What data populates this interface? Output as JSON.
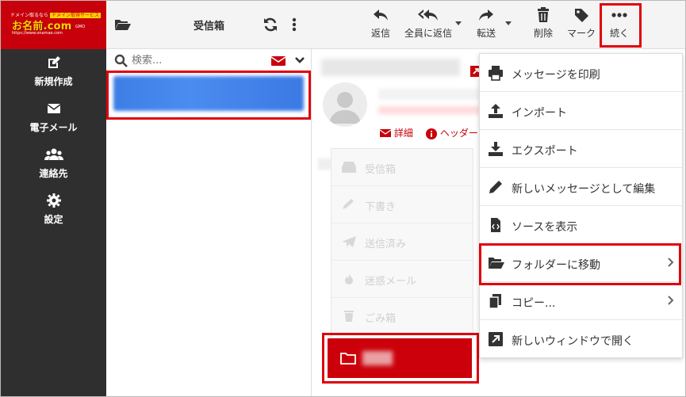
{
  "brand": {
    "top_text": "ドメイン取るなら",
    "top_tag": "ドメイン取得サービス",
    "name": "お名前.com",
    "url": "https://www.onamae.com",
    "badge": "GMO"
  },
  "sidebar": {
    "items": [
      {
        "label": "新規作成",
        "icon": "compose-icon"
      },
      {
        "label": "電子メール",
        "icon": "envelope-icon"
      },
      {
        "label": "連絡先",
        "icon": "users-icon"
      },
      {
        "label": "設定",
        "icon": "gear-icon"
      }
    ]
  },
  "folders_header": {
    "title": "受信箱"
  },
  "search": {
    "placeholder": "検索..."
  },
  "toolbar": {
    "reply": "返信",
    "reply_all": "全員に返信",
    "forward": "転送",
    "delete": "削除",
    "mark": "マーク",
    "more": "続く"
  },
  "reading": {
    "detail_link": "詳細",
    "headers_link": "ヘッダー"
  },
  "folder_popup": {
    "items": [
      "受信箱",
      "下書き",
      "送信済み",
      "迷惑メール",
      "ごみ箱"
    ]
  },
  "more_menu": {
    "items": [
      {
        "label": "メッセージを印刷",
        "icon": "print-icon",
        "submenu": false
      },
      {
        "label": "インポート",
        "icon": "upload-icon",
        "submenu": false
      },
      {
        "label": "エクスポート",
        "icon": "download-icon",
        "submenu": false
      },
      {
        "label": "新しいメッセージとして編集",
        "icon": "pencil-icon",
        "submenu": false
      },
      {
        "label": "ソースを表示",
        "icon": "code-file-icon",
        "submenu": false
      },
      {
        "label": "フォルダーに移動",
        "icon": "folder-open-icon",
        "submenu": true
      },
      {
        "label": "コピー...",
        "icon": "copy-icon",
        "submenu": true
      },
      {
        "label": "新しいウィンドウで開く",
        "icon": "external-link-icon",
        "submenu": false
      }
    ]
  },
  "colors": {
    "brand_red": "#c8000b",
    "highlight": "#e0000b",
    "sidebar_bg": "#2f2f2f",
    "selection_blue": "#3d7ee6"
  }
}
